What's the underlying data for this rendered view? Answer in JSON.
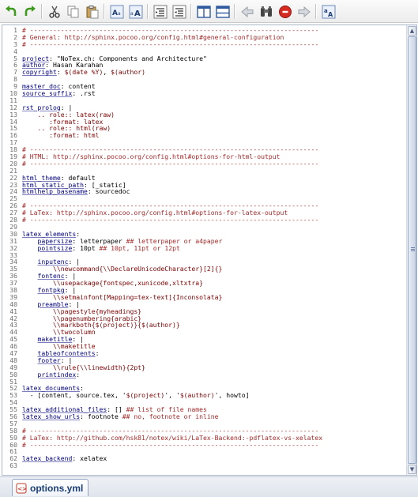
{
  "toolbar": {
    "buttons": [
      {
        "name": "undo-button",
        "icon": "undo-icon"
      },
      {
        "name": "redo-button",
        "icon": "redo-icon"
      },
      {
        "name": "cut-button",
        "icon": "cut-icon"
      },
      {
        "name": "copy-button",
        "icon": "copy-icon"
      },
      {
        "name": "paste-button",
        "icon": "paste-icon"
      },
      {
        "name": "font-smaller-button",
        "icon": "font-smaller-icon"
      },
      {
        "name": "font-larger-button",
        "icon": "font-larger-icon"
      },
      {
        "name": "indent-button",
        "icon": "indent-icon"
      },
      {
        "name": "outdent-button",
        "icon": "outdent-icon"
      },
      {
        "name": "split-vertical-button",
        "icon": "split-vertical-icon"
      },
      {
        "name": "split-horizontal-button",
        "icon": "split-horizontal-icon"
      },
      {
        "name": "back-button",
        "icon": "arrow-left-icon"
      },
      {
        "name": "find-button",
        "icon": "binoculars-icon"
      },
      {
        "name": "stop-button",
        "icon": "stop-icon"
      },
      {
        "name": "forward-button",
        "icon": "arrow-right-icon"
      },
      {
        "name": "spellcheck-button",
        "icon": "spellcheck-icon"
      }
    ]
  },
  "editor": {
    "lines": [
      {
        "n": "1",
        "text": "# ---------------------------------------------------------------------------"
      },
      {
        "n": "2",
        "text": "# General: http://sphinx.pocoo.org/config.html#general-configuration"
      },
      {
        "n": "3",
        "text": "# ---------------------------------------------------------------------------"
      },
      {
        "n": "4",
        "text": ""
      },
      {
        "n": "5",
        "text": "project: \"NoTex.ch: Components and Architecture\""
      },
      {
        "n": "6",
        "text": "author: Hasan Karahan"
      },
      {
        "n": "7",
        "text": "copyright: $(date %Y), $(author)"
      },
      {
        "n": "8",
        "text": ""
      },
      {
        "n": "9",
        "text": "master_doc: content"
      },
      {
        "n": "10",
        "text": "source_suffix: .rst"
      },
      {
        "n": "11",
        "text": ""
      },
      {
        "n": "12",
        "text": "rst_prolog: |"
      },
      {
        "n": "13",
        "text": "    .. role:: latex(raw)"
      },
      {
        "n": "14",
        "text": "       :format: latex"
      },
      {
        "n": "15",
        "text": "    .. role:: html(raw)"
      },
      {
        "n": "16",
        "text": "       :format: html"
      },
      {
        "n": "17",
        "text": ""
      },
      {
        "n": "18",
        "text": "# ---------------------------------------------------------------------------"
      },
      {
        "n": "19",
        "text": "# HTML: http://sphinx.pocoo.org/config.html#options-for-html-output"
      },
      {
        "n": "20",
        "text": "# ---------------------------------------------------------------------------"
      },
      {
        "n": "21",
        "text": ""
      },
      {
        "n": "22",
        "text": "html_theme: default"
      },
      {
        "n": "23",
        "text": "html_static_path: [_static]"
      },
      {
        "n": "24",
        "text": "htmlhelp_basename: sourcedoc"
      },
      {
        "n": "25",
        "text": ""
      },
      {
        "n": "26",
        "text": "# ---------------------------------------------------------------------------"
      },
      {
        "n": "27",
        "text": "# LaTex: http://sphinx.pocoo.org/config.html#options-for-latex-output"
      },
      {
        "n": "28",
        "text": "# ---------------------------------------------------------------------------"
      },
      {
        "n": "29",
        "text": ""
      },
      {
        "n": "30",
        "text": "latex_elements:"
      },
      {
        "n": "31",
        "text": "    papersize: letterpaper ## letterpaper or a4paper"
      },
      {
        "n": "32",
        "text": "    pointsize: 10pt ## 10pt, 11pt or 12pt"
      },
      {
        "n": "33",
        "text": ""
      },
      {
        "n": "34",
        "text": "    inputenc: |"
      },
      {
        "n": "35",
        "text": "        \\\\newcommand{\\\\DeclareUnicodeCharacter}[2]{}"
      },
      {
        "n": "36",
        "text": "    fontenc: |"
      },
      {
        "n": "37",
        "text": "        \\\\usepackage{fontspec,xunicode,xltxtra}"
      },
      {
        "n": "38",
        "text": "    fontpkg: |"
      },
      {
        "n": "39",
        "text": "        \\\\setmainfont[Mapping=tex-text]{Inconsolata}"
      },
      {
        "n": "40",
        "text": "    preamble: |"
      },
      {
        "n": "41",
        "text": "        \\\\pagestyle{myheadings}"
      },
      {
        "n": "42",
        "text": "        \\\\pagenumbering{arabic}"
      },
      {
        "n": "43",
        "text": "        \\\\markboth{$(project)}{$(author)}"
      },
      {
        "n": "44",
        "text": "        \\\\twocolumn"
      },
      {
        "n": "45",
        "text": "    maketitle: |"
      },
      {
        "n": "46",
        "text": "        \\\\maketitle"
      },
      {
        "n": "47",
        "text": "    tableofcontents:"
      },
      {
        "n": "48",
        "text": "    footer: |"
      },
      {
        "n": "49",
        "text": "        \\\\rule{\\\\linewidth}{2pt}"
      },
      {
        "n": "50",
        "text": "    printindex:"
      },
      {
        "n": "51",
        "text": ""
      },
      {
        "n": "52",
        "text": "latex_documents:"
      },
      {
        "n": "53",
        "text": "  - [content, source.tex, '$(project)', '$(author)', howto]"
      },
      {
        "n": "54",
        "text": ""
      },
      {
        "n": "55",
        "text": "latex_additional_files: [] ## list of file names"
      },
      {
        "n": "56",
        "text": "latex_show_urls: footnote ## no, footnote or inline"
      },
      {
        "n": "57",
        "text": ""
      },
      {
        "n": "58",
        "text": "# ---------------------------------------------------------------------------"
      },
      {
        "n": "59",
        "text": "# LaTex: http://github.com/hsk81/notex/wiki/LaTex-Backend:-pdflatex-vs-xelatex"
      },
      {
        "n": "60",
        "text": "# ---------------------------------------------------------------------------"
      },
      {
        "n": "61",
        "text": ""
      },
      {
        "n": "62",
        "text": "latex_backend: xelatex"
      },
      {
        "n": "63",
        "text": ""
      }
    ]
  },
  "tabs": [
    {
      "label": "options.yml",
      "icon": "yaml-file-icon"
    }
  ],
  "colors": {
    "comment": "#a52a2a",
    "key": "#00007f",
    "string": "#7f0000",
    "tab_text": "#1b3f75"
  }
}
